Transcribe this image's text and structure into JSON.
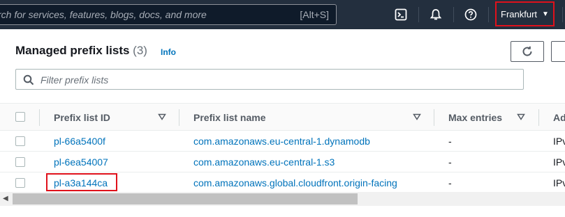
{
  "topbar": {
    "search_placeholder": "rch for services, features, blogs, docs, and more",
    "search_shortcut": "[Alt+S]",
    "region": "Frankfurt",
    "icons": [
      "cloudshell-icon",
      "bell-icon",
      "help-icon"
    ]
  },
  "panel": {
    "title": "Managed prefix lists",
    "count": "(3)",
    "info_link": "Info",
    "filter_placeholder": "Filter prefix lists"
  },
  "table": {
    "columns": [
      "Prefix list ID",
      "Prefix list name",
      "Max entries",
      "Ad"
    ],
    "rows": [
      {
        "id": "pl-66a5400f",
        "name": "com.amazonaws.eu-central-1.dynamodb",
        "max_entries": "-",
        "address_family": "IPv"
      },
      {
        "id": "pl-6ea54007",
        "name": "com.amazonaws.eu-central-1.s3",
        "max_entries": "-",
        "address_family": "IPv"
      },
      {
        "id": "pl-a3a144ca",
        "name": "com.amazonaws.global.cloudfront.origin-facing",
        "max_entries": "-",
        "address_family": "IPv"
      }
    ]
  },
  "colors": {
    "nav_bg": "#232f3e",
    "link": "#0073bb",
    "highlight": "#e0111b"
  }
}
